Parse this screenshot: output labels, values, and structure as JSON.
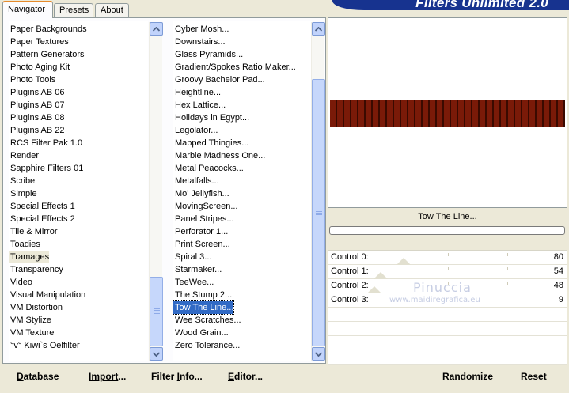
{
  "tabs": [
    {
      "label": "Navigator",
      "active": true
    },
    {
      "label": "Presets",
      "active": false
    },
    {
      "label": "About",
      "active": false
    }
  ],
  "banner": {
    "title": "Filters Unlimited 2.0"
  },
  "categories": {
    "items": [
      "Paper Backgrounds",
      "Paper Textures",
      "Pattern Generators",
      "Photo Aging Kit",
      "Photo Tools",
      "Plugins AB 06",
      "Plugins AB 07",
      "Plugins AB 08",
      "Plugins AB 22",
      "RCS Filter Pak 1.0",
      "Render",
      "Sapphire Filters 01",
      "Scribe",
      "Simple",
      "Special Effects 1",
      "Special Effects 2",
      "Tile & Mirror",
      "Toadies",
      "Tramages",
      "Transparency",
      "Video",
      "Visual Manipulation",
      "VM Distortion",
      "VM Stylize",
      "VM Texture",
      "°v° Kiwi`s Oelfilter"
    ],
    "selected": "Tramages"
  },
  "filters": {
    "items": [
      "Cyber Mosh...",
      "Downstairs...",
      "Glass Pyramids...",
      "Gradient/Spokes Ratio Maker...",
      "Groovy Bachelor Pad...",
      "Heightline...",
      "Hex Lattice...",
      "Holidays in Egypt...",
      "Legolator...",
      "Mapped Thingies...",
      "Marble Madness One...",
      "Metal Peacocks...",
      "Metalfalls...",
      "Mo' Jellyfish...",
      "MovingScreen...",
      "Panel Stripes...",
      "Perforator 1...",
      "Print Screen...",
      "Spiral 3...",
      "Starmaker...",
      "TeeWee...",
      "The Stump 2...",
      "Tow The Line...",
      "Wee Scratches...",
      "Wood Grain...",
      "Zero Tolerance..."
    ],
    "selected": "Tow The Line..."
  },
  "preview": {
    "filter_name": "Tow The Line...",
    "stripe_color": "#7a1a08"
  },
  "controls": [
    {
      "label": "Control 0:",
      "value": "80"
    },
    {
      "label": "Control 1:",
      "value": "54"
    },
    {
      "label": "Control 2:",
      "value": "48"
    },
    {
      "label": "Control 3:",
      "value": "9"
    }
  ],
  "watermark": {
    "name": "Pinuccia",
    "url": "www.maidiregrafica.eu"
  },
  "buttons": {
    "database": {
      "u": "D",
      "rest": "atabase"
    },
    "import": {
      "pre": "Import",
      "rest": "..."
    },
    "filter_info": {
      "pre": "Filter ",
      "u": "I",
      "rest": "nfo..."
    },
    "editor": {
      "u": "E",
      "rest": "ditor..."
    },
    "randomize": "Randomize",
    "reset": "Reset"
  },
  "colors": {
    "accent_tab": "#e68b2c",
    "selection": "#316ac5",
    "banner": "#17338f"
  }
}
